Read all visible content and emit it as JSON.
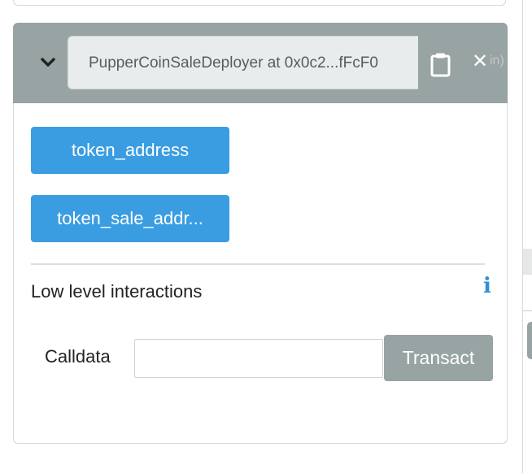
{
  "instance": {
    "label": "PupperCoinSaleDeployer at 0x0c2...fFcF0",
    "tail_text": "in)",
    "icons": {
      "expand": "chevron-down-icon",
      "copy": "clipboard-icon",
      "close": "close-icon"
    },
    "close_glyph": "✕"
  },
  "functions": [
    {
      "label": "token_address"
    },
    {
      "label": "token_sale_addr..."
    }
  ],
  "low_level": {
    "title": "Low level interactions",
    "info_glyph": "i",
    "calldata_label": "Calldata",
    "calldata_value": "",
    "transact_label": "Transact"
  },
  "colors": {
    "header_bg": "#98a3a3",
    "function_button": "#3a9de1",
    "transact_button": "#98a3a3",
    "info_icon": "#2f8fd8"
  }
}
